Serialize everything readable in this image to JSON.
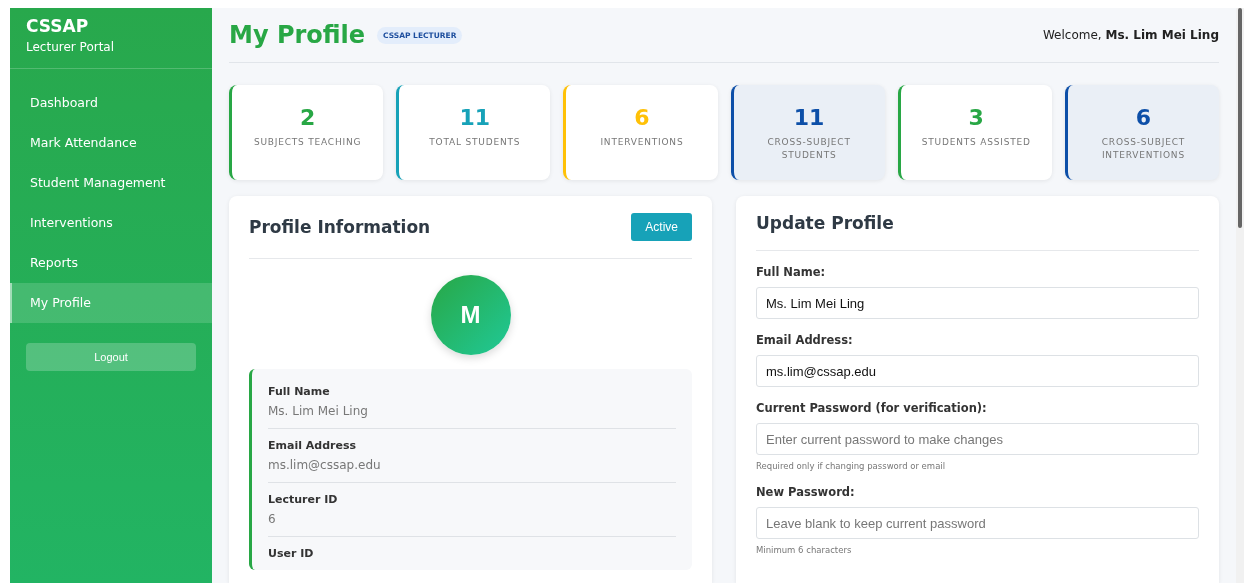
{
  "sidebar": {
    "brand": "CSSAP",
    "subtitle": "Lecturer Portal",
    "items": [
      {
        "label": "Dashboard",
        "selected": false
      },
      {
        "label": "Mark Attendance",
        "selected": false
      },
      {
        "label": "Student Management",
        "selected": false
      },
      {
        "label": "Interventions",
        "selected": false
      },
      {
        "label": "Reports",
        "selected": false
      },
      {
        "label": "My Profile",
        "selected": true
      }
    ],
    "logout": "Logout"
  },
  "header": {
    "title": "My Profile",
    "badge": "CSSAP LECTURER",
    "welcome": "Welcome, **Ms. Lim Mei Ling**"
  },
  "stats": [
    {
      "value": "2",
      "label": "SUBJECTS TEACHING",
      "color": "#28a745",
      "shaded": false
    },
    {
      "value": "11",
      "label": "TOTAL STUDENTS",
      "color": "#17a2b8",
      "shaded": false
    },
    {
      "value": "6",
      "label": "INTERVENTIONS",
      "color": "#ffc107",
      "shaded": false
    },
    {
      "value": "11",
      "label": "CROSS-SUBJECT STUDENTS",
      "color": "#0d4fa8",
      "shaded": true
    },
    {
      "value": "3",
      "label": "STUDENTS ASSISTED",
      "color": "#28a745",
      "shaded": false
    },
    {
      "value": "6",
      "label": "CROSS-SUBJECT INTERVENTIONS",
      "color": "#0d4fa8",
      "shaded": true
    }
  ],
  "profile_info": {
    "title": "Profile Information",
    "status": "Active",
    "avatar": "M",
    "fields": [
      {
        "label": "Full Name",
        "value": "Ms. Lim Mei Ling"
      },
      {
        "label": "Email Address",
        "value": "ms.lim@cssap.edu"
      },
      {
        "label": "Lecturer ID",
        "value": "6"
      },
      {
        "label": "User ID"
      }
    ]
  },
  "update_profile": {
    "title": "Update Profile",
    "fields": [
      {
        "label": "Full Name:",
        "value": "Ms. Lim Mei Ling"
      },
      {
        "label": "Email Address:",
        "value": "ms.lim@cssap.edu"
      },
      {
        "label": "Current Password (for verification):",
        "placeholder": "Enter current password to make changes",
        "hint": "Required only if changing password or email"
      },
      {
        "label": "New Password:",
        "placeholder": "Leave blank to keep current password",
        "hint": "Minimum 6 characters"
      }
    ]
  }
}
